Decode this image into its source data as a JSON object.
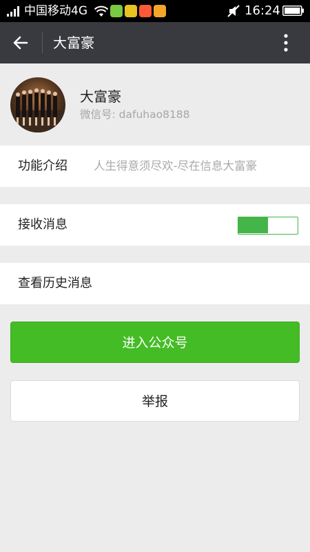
{
  "status_bar": {
    "carrier": "中国移动4G",
    "time": "16:24",
    "icons": [
      "signal-icon",
      "wifi-icon",
      "notification-app-icon",
      "notification-app-icon",
      "notification-app-icon",
      "notification-app-icon",
      "mute-icon",
      "battery-icon"
    ]
  },
  "action_bar": {
    "back_icon": "arrow-left-icon",
    "title": "大富豪",
    "more_icon": "more-vertical-icon"
  },
  "profile": {
    "name": "大富豪",
    "wechat_id_label": "微信号: ",
    "wechat_id": "dafuhao8188"
  },
  "intro": {
    "label": "功能介绍",
    "value": "人生得意须尽欢-尽在信息大富豪"
  },
  "receive_messages": {
    "label": "接收消息",
    "enabled": true
  },
  "history": {
    "label": "查看历史消息"
  },
  "buttons": {
    "enter": "进入公众号",
    "report": "举报"
  },
  "colors": {
    "accent_green": "#44bc25",
    "action_bar": "#393a3f",
    "background": "#ececec"
  }
}
